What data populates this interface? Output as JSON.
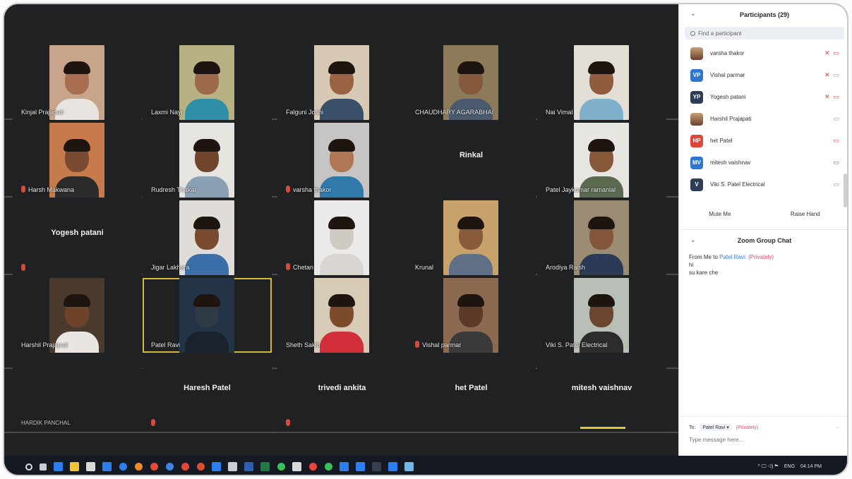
{
  "participants_panel": {
    "title": "Participants (29)",
    "search_placeholder": "Find a participant",
    "items": [
      {
        "name": "varsha thakor",
        "avatar": "",
        "avatar_color": "#b0715a",
        "mic_muted": true,
        "video_off": true
      },
      {
        "name": "Vishal parmar",
        "avatar": "VP",
        "avatar_color": "#2e77d0",
        "mic_muted": true,
        "video_off": false
      },
      {
        "name": "Yogesh patani",
        "avatar": "YP",
        "avatar_color": "#2c3e57",
        "mic_muted": true,
        "video_off": true
      },
      {
        "name": "Harshil Prajapati",
        "avatar": "",
        "avatar_color": "#6b3f2a",
        "mic_muted": false,
        "video_off": false
      },
      {
        "name": "het Patel",
        "avatar": "HP",
        "avatar_color": "#e0453a",
        "mic_muted": false,
        "video_off": true
      },
      {
        "name": "mitesh vaishnav",
        "avatar": "MV",
        "avatar_color": "#2e77d0",
        "mic_muted": false,
        "video_off": true
      },
      {
        "name": "Viki S. Patel Electrical",
        "avatar": "V",
        "avatar_color": "#2c3e57",
        "mic_muted": false,
        "video_off": false
      }
    ],
    "mute_me_label": "Mute Me",
    "raise_hand_label": "Raise Hand"
  },
  "chat": {
    "title": "Zoom Group Chat",
    "from_prefix": "From Me to",
    "from_target": "Patel Ravi:",
    "privately": "(Privately)",
    "messages": [
      "hi",
      "su kare che"
    ],
    "to_label": "To:",
    "to_value": "Patel Ravi",
    "to_privately": "(Privately)",
    "more": "···",
    "input_placeholder": "Type message here..."
  },
  "grid": {
    "rows": [
      [
        {
          "name": "Kinjal Prajapati",
          "muted": false,
          "bg": "#c8a58a",
          "shirt": "#e9e3df",
          "skin": "#a86e4f"
        },
        {
          "name": "Laxmi Nayi",
          "muted": false,
          "bg": "#b7b184",
          "shirt": "#2e8fa6",
          "skin": "#9c6a4a"
        },
        {
          "name": "Falguni Joshi",
          "muted": false,
          "bg": "#d8c9b5",
          "shirt": "#3a4f6a",
          "skin": "#9b6244"
        },
        {
          "name": "CHAUDHARY AGARABHAI",
          "muted": false,
          "bg": "#8c7a5a",
          "shirt": "#4b5a6e",
          "skin": "#855a3c"
        },
        {
          "name": "Nai Vimal",
          "muted": false,
          "bg": "#e4dfd6",
          "shirt": "#7fb1cc",
          "skin": "#8f5d3e"
        }
      ],
      [
        {
          "name": "Harsh Makwana",
          "muted": true,
          "bg": "#c77a4b",
          "shirt": "#2b2b2b",
          "skin": "#7b4b31"
        },
        {
          "name": "Rudresh Thakar",
          "muted": false,
          "bg": "#e6e4e0",
          "shirt": "#8aa0b5",
          "skin": "#70452c"
        },
        {
          "name": "varsha thakor",
          "muted": true,
          "bg": "#c7c4c4",
          "shirt": "#2f7aa8",
          "skin": "#b07755"
        },
        {
          "name": "Rinkal",
          "muted": false,
          "bg": "",
          "shirt": "",
          "skin": ""
        },
        {
          "name": "Patel Jaykumar ramanlal",
          "muted": false,
          "bg": "#e8e6e2",
          "shirt": "#5b6a4f",
          "skin": "#86583a"
        }
      ],
      [
        {
          "name": "Yogesh patani",
          "muted": true,
          "bg": "",
          "shirt": "",
          "skin": ""
        },
        {
          "name": "Jigar Lakhara",
          "muted": false,
          "bg": "#e0ddd8",
          "shirt": "#3c6fa8",
          "skin": "#7a4a2e"
        },
        {
          "name": "Chetan",
          "muted": true,
          "bg": "#eceae8",
          "shirt": "#d9d6d2",
          "skin": "#cfcac4"
        },
        {
          "name": "Krunal",
          "muted": false,
          "bg": "#c7a36b",
          "shirt": "#5f6f87",
          "skin": "#8a5b3b"
        },
        {
          "name": "Arodiya Raish",
          "muted": false,
          "bg": "#9a8b72",
          "shirt": "#2b3a55",
          "skin": "#84573a"
        }
      ],
      [
        {
          "name": "Harshil Prajapati",
          "muted": false,
          "bg": "#4a3a2e",
          "shirt": "#e9e6e2",
          "skin": "#6e432a"
        },
        {
          "name": "Patel Ravi",
          "muted": false,
          "bg": "#233447",
          "shirt": "#1a222b",
          "skin": "#2e3a46",
          "selected": true
        },
        {
          "name": "Sheth Sakib",
          "muted": false,
          "bg": "#d8cbb7",
          "shirt": "#d1303a",
          "skin": "#7c4b2c"
        },
        {
          "name": "Vishal parmar",
          "muted": true,
          "bg": "#8c6a52",
          "shirt": "#3a3a3a",
          "skin": "#5b3b28"
        },
        {
          "name": "Viki S. Patel Electrical",
          "muted": false,
          "bg": "#b8bfb6",
          "shirt": "#2c2c2c",
          "skin": "#6a4530"
        }
      ],
      [
        {
          "name": "HARDIK PANCHAL",
          "muted": false,
          "bg": "",
          "shirt": "",
          "skin": "",
          "dim": true
        },
        {
          "name": "Haresh Patel",
          "muted": true,
          "bg": "",
          "shirt": "",
          "skin": ""
        },
        {
          "name": "trivedi ankita",
          "muted": true,
          "bg": "",
          "shirt": "",
          "skin": ""
        },
        {
          "name": "het Patel",
          "muted": false,
          "bg": "",
          "shirt": "",
          "skin": ""
        },
        {
          "name": "mitesh vaishnav",
          "muted": false,
          "bg": "",
          "shirt": "",
          "skin": ""
        }
      ]
    ]
  },
  "taskbar": {
    "tray_lang": "ENG",
    "tray_time": "04:14 PM",
    "tray_icons": "^ 🖵 ◁) ☁"
  }
}
